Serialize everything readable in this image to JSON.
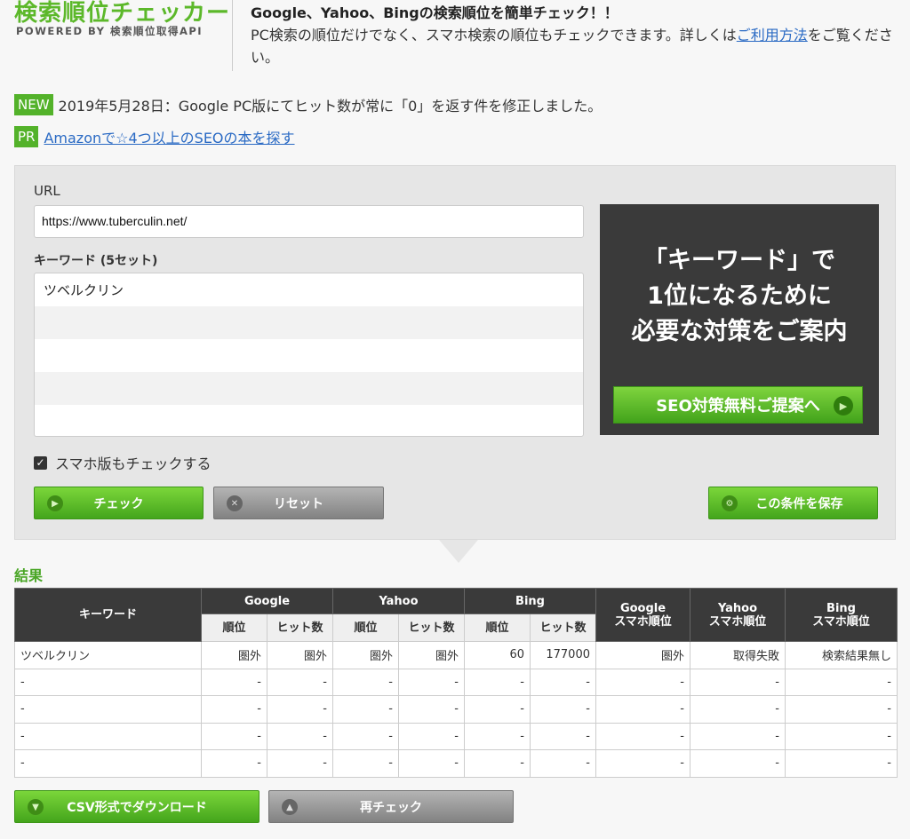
{
  "header": {
    "logo_title": "検索順位チェッカー",
    "logo_sub": "POWERED BY 検索順位取得API",
    "headline": "Google、Yahoo、Bingの検索順位を簡単チェック！！",
    "desc_before": "PC検索の順位だけでなく、スマホ検索の順位もチェックできます。詳しくは",
    "desc_link": "ご利用方法",
    "desc_after": "をご覧ください。"
  },
  "notices": {
    "new_badge": "NEW",
    "new_text": "2019年5月28日：Google PC版にてヒット数が常に「0」を返す件を修正しました。",
    "pr_badge": "PR",
    "pr_link": "Amazonで☆4つ以上のSEOの本を探す"
  },
  "form": {
    "url_label": "URL",
    "url_value": "https://www.tuberculin.net/",
    "keyword_label": "キーワード (5セット)",
    "keywords": [
      "ツベルクリン",
      "",
      "",
      "",
      ""
    ],
    "smartphone_check_label": "スマホ版もチェックする",
    "smartphone_checked": true,
    "check_button": "チェック",
    "reset_button": "リセット",
    "save_button": "この条件を保存"
  },
  "ad": {
    "line1": "「キーワード」で",
    "line2": "1位になるために",
    "line3": "必要な対策をご案内",
    "button": "SEO対策無料ご提案へ"
  },
  "results": {
    "heading": "結果",
    "col_keyword": "キーワード",
    "groups": [
      "Google",
      "Yahoo",
      "Bing"
    ],
    "sub_rank": "順位",
    "sub_hits": "ヒット数",
    "mobile_google_1": "Google",
    "mobile_google_2": "スマホ順位",
    "mobile_yahoo_1": "Yahoo",
    "mobile_yahoo_2": "スマホ順位",
    "mobile_bing_1": "Bing",
    "mobile_bing_2": "スマホ順位",
    "rows": [
      [
        "ツベルクリン",
        "圏外",
        "圏外",
        "圏外",
        "圏外",
        "60",
        "177000",
        "圏外",
        "取得失敗",
        "検索結果無し"
      ],
      [
        "-",
        "-",
        "-",
        "-",
        "-",
        "-",
        "-",
        "-",
        "-",
        "-"
      ],
      [
        "-",
        "-",
        "-",
        "-",
        "-",
        "-",
        "-",
        "-",
        "-",
        "-"
      ],
      [
        "-",
        "-",
        "-",
        "-",
        "-",
        "-",
        "-",
        "-",
        "-",
        "-"
      ],
      [
        "-",
        "-",
        "-",
        "-",
        "-",
        "-",
        "-",
        "-",
        "-",
        "-"
      ]
    ],
    "csv_button": "CSV形式でダウンロード",
    "recheck_button": "再チェック"
  },
  "colors": {
    "brand_green": "#5cb82a",
    "dark_header": "#3a3a3a",
    "link_blue": "#2a6ac4"
  },
  "icons": {
    "check_button_icon": "arrow-right-circle-icon",
    "reset_button_icon": "x-circle-icon",
    "save_button_icon": "gear-circle-icon",
    "csv_button_icon": "arrow-down-circle-icon",
    "recheck_button_icon": "arrow-up-circle-icon",
    "ad_button_icon": "arrow-right-circle-icon"
  }
}
